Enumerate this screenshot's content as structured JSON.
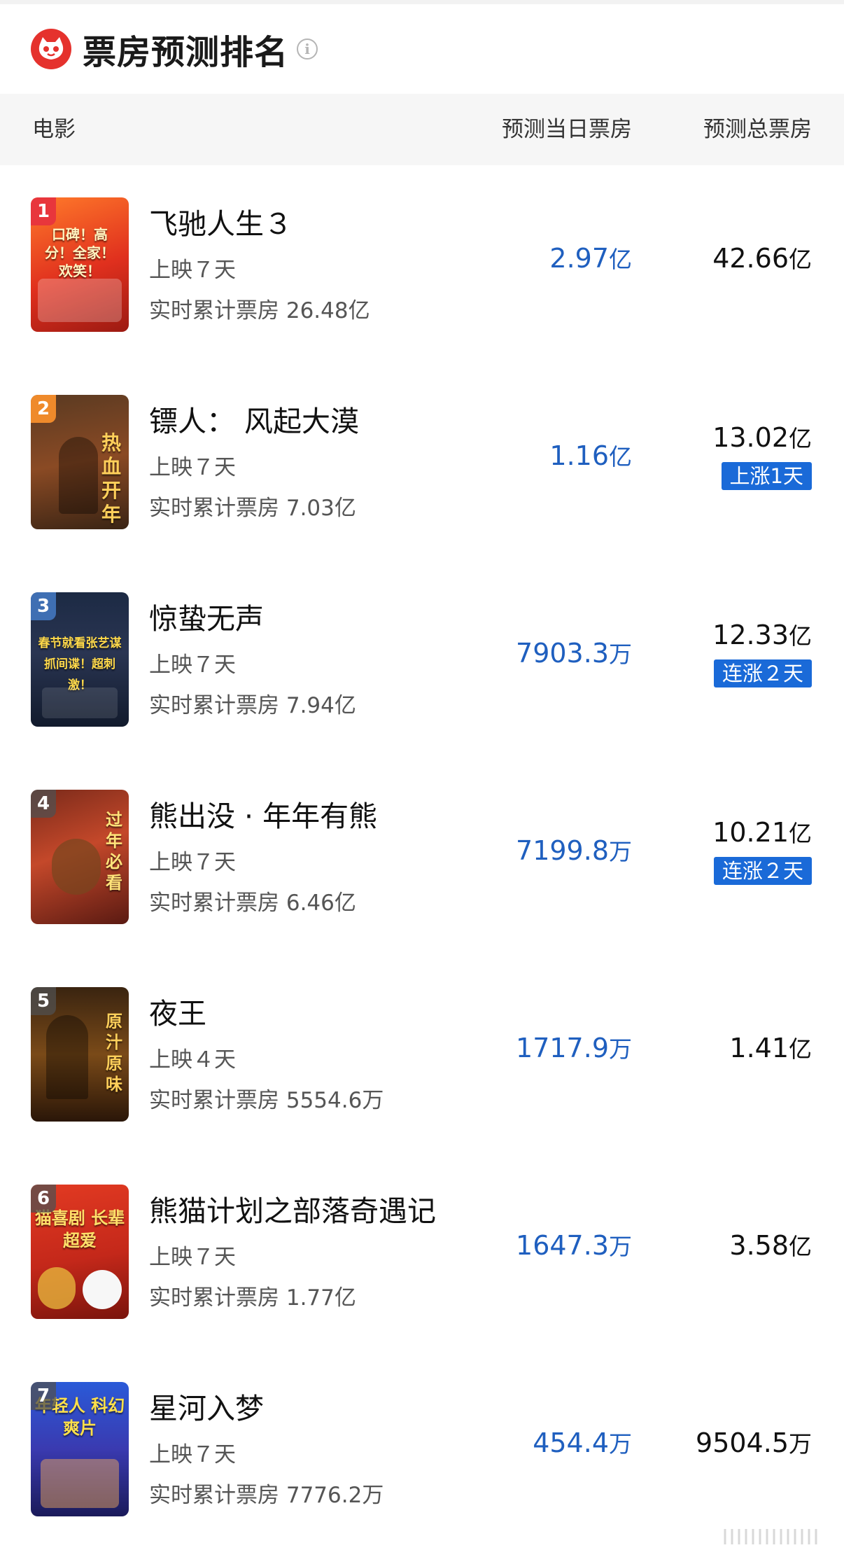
{
  "header": {
    "title": "票房预测排名",
    "info_glyph": "i",
    "logo_icon": "cat-logo-icon"
  },
  "columns": {
    "movie": "电影",
    "daily": "预测当日票房",
    "total": "预测总票房"
  },
  "colors": {
    "accent_blue": "#1f5fbf",
    "tag_blue": "#1a6ad8",
    "brand_red": "#e5322d"
  },
  "movies": [
    {
      "rank": "1",
      "name": "飞驰人生３",
      "days": "上映７天",
      "cumulative": "实时累计票房 26.48亿",
      "daily_value": "2.97",
      "daily_unit": "亿",
      "total_value": "42.66",
      "total_unit": "亿",
      "tag": "",
      "poster_text": "口碑！高分！全家！欢笑！"
    },
    {
      "rank": "2",
      "name": "镖人： 风起大漠",
      "days": "上映７天",
      "cumulative": "实时累计票房 7.03亿",
      "daily_value": "1.16",
      "daily_unit": "亿",
      "total_value": "13.02",
      "total_unit": "亿",
      "tag": "上涨1天",
      "poster_text": "热血开年"
    },
    {
      "rank": "3",
      "name": "惊蛰无声",
      "days": "上映７天",
      "cumulative": "实时累计票房 7.94亿",
      "daily_value": "7903.3",
      "daily_unit": "万",
      "total_value": "12.33",
      "total_unit": "亿",
      "tag": "连涨２天",
      "poster_text": "春节就看张艺谋 抓间谍！超刺激！"
    },
    {
      "rank": "4",
      "name": "熊出没 · 年年有熊",
      "days": "上映７天",
      "cumulative": "实时累计票房 6.46亿",
      "daily_value": "7199.8",
      "daily_unit": "万",
      "total_value": "10.21",
      "total_unit": "亿",
      "tag": "连涨２天",
      "poster_text": "过年必看"
    },
    {
      "rank": "5",
      "name": "夜王",
      "days": "上映４天",
      "cumulative": "实时累计票房 5554.6万",
      "daily_value": "1717.9",
      "daily_unit": "万",
      "total_value": "1.41",
      "total_unit": "亿",
      "tag": "",
      "poster_text": "原汁原味"
    },
    {
      "rank": "6",
      "name": "熊猫计划之部落奇遇记",
      "days": "上映７天",
      "cumulative": "实时累计票房 1.77亿",
      "daily_value": "1647.3",
      "daily_unit": "万",
      "total_value": "3.58",
      "total_unit": "亿",
      "tag": "",
      "poster_text": "猫喜剧 长辈超爱"
    },
    {
      "rank": "7",
      "name": "星河入梦",
      "days": "上映７天",
      "cumulative": "实时累计票房 7776.2万",
      "daily_value": "454.4",
      "daily_unit": "万",
      "total_value": "9504.5",
      "total_unit": "万",
      "tag": "",
      "poster_text": "年轻人 科幻爽片"
    }
  ]
}
